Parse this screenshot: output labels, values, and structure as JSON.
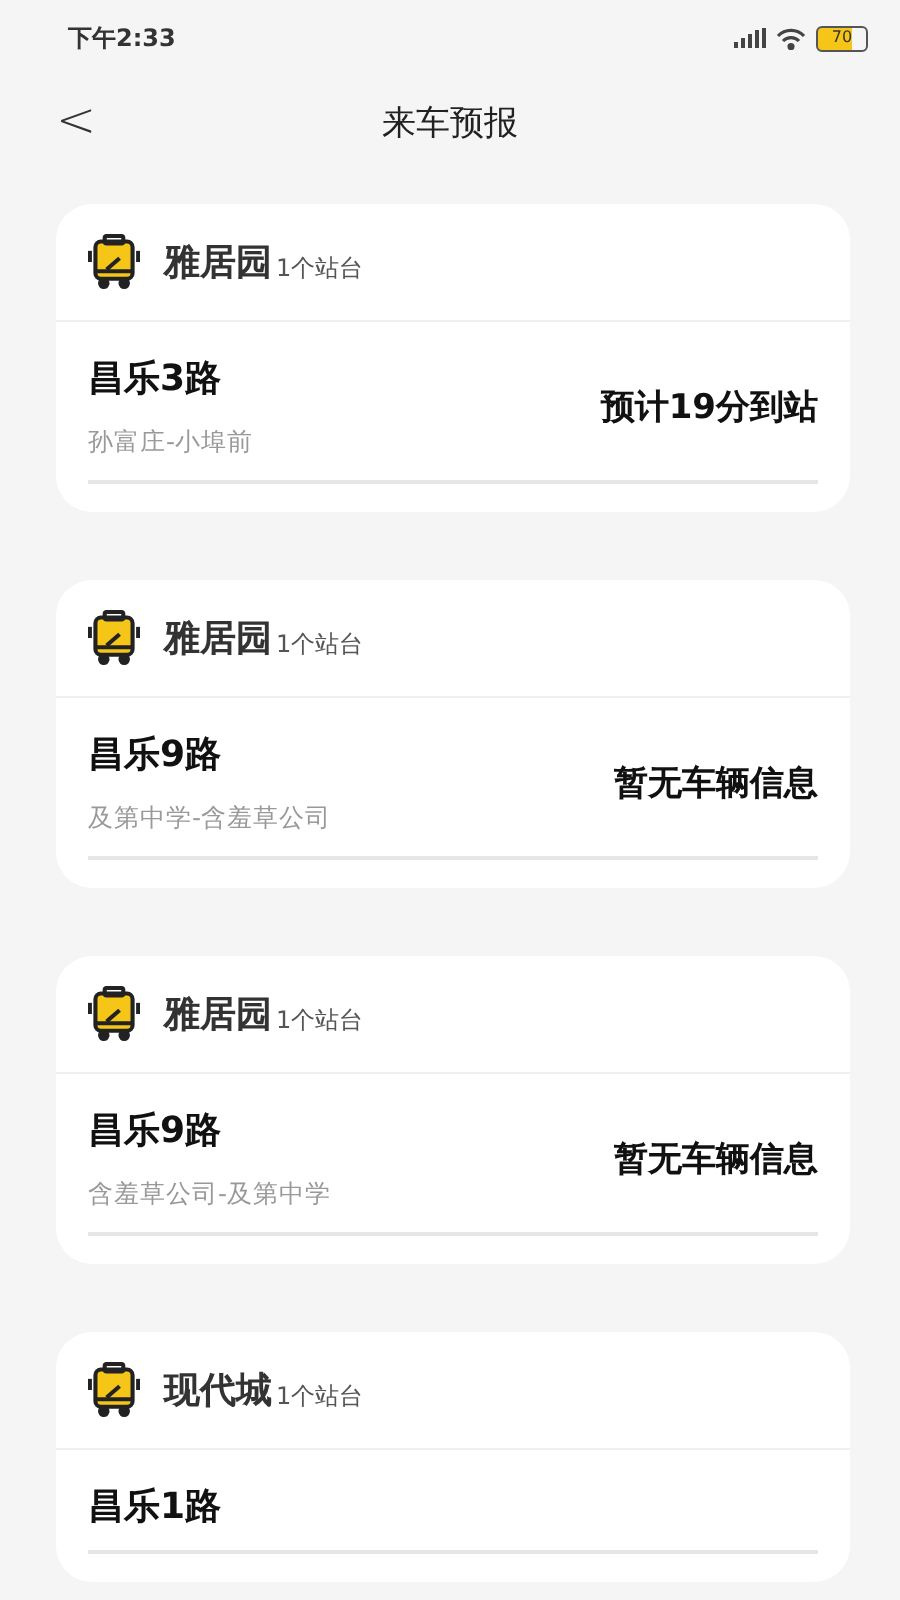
{
  "status_bar": {
    "time": "下午2:33",
    "battery": "70"
  },
  "nav": {
    "back": "<",
    "title": "来车预报"
  },
  "stations": [
    {
      "name": "雅居园",
      "count": "1个站台",
      "route": {
        "name": "昌乐3路",
        "stops": "孙富庄-小埠前",
        "arrival": "预计19分到站"
      }
    },
    {
      "name": "雅居园",
      "count": "1个站台",
      "route": {
        "name": "昌乐9路",
        "stops": "及第中学-含羞草公司",
        "arrival": "暂无车辆信息"
      }
    },
    {
      "name": "雅居园",
      "count": "1个站台",
      "route": {
        "name": "昌乐9路",
        "stops": "含羞草公司-及第中学",
        "arrival": "暂无车辆信息"
      }
    },
    {
      "name": "现代城",
      "count": "1个站台",
      "route": {
        "name": "昌乐1路"
      }
    }
  ]
}
